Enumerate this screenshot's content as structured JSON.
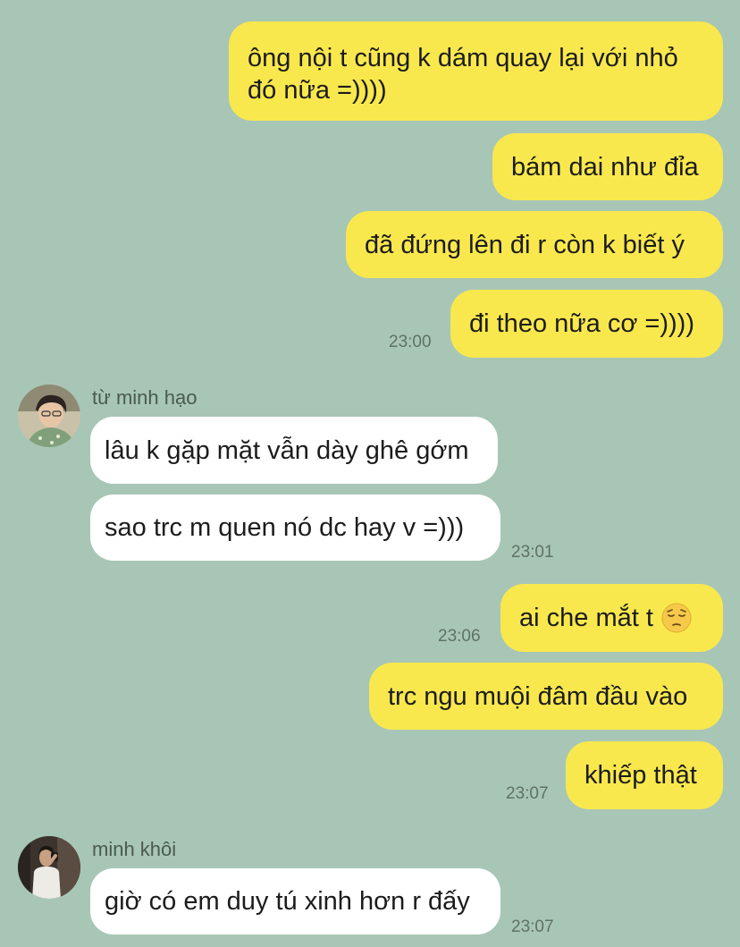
{
  "messages": [
    {
      "text": "ông nội t cũng k dám quay lại với nhỏ đó nữa =))))"
    },
    {
      "text": "bám dai như đỉa"
    },
    {
      "text": "đã đứng lên đi r còn k biết ý"
    },
    {
      "text": "đi theo nữa cơ =))))",
      "time": "23:00"
    },
    {
      "sender": "từ minh hạo",
      "text": "lâu k gặp mặt vẫn dày ghê gớm"
    },
    {
      "text": "sao trc m quen nó dc hay v =)))",
      "time": "23:01"
    },
    {
      "text": "ai che mắt t",
      "emoji": "pensive-face",
      "time": "23:06"
    },
    {
      "text": "trc ngu muội đâm đầu vào"
    },
    {
      "text": "khiếp thật",
      "time": "23:07"
    },
    {
      "sender": "minh khôi",
      "text": "giờ có em duy tú xinh hơn r đấy",
      "time": "23:07"
    }
  ],
  "colors": {
    "background": "#a8c6b6",
    "outgoing_bubble": "#f9e84d",
    "incoming_bubble": "#ffffff"
  }
}
